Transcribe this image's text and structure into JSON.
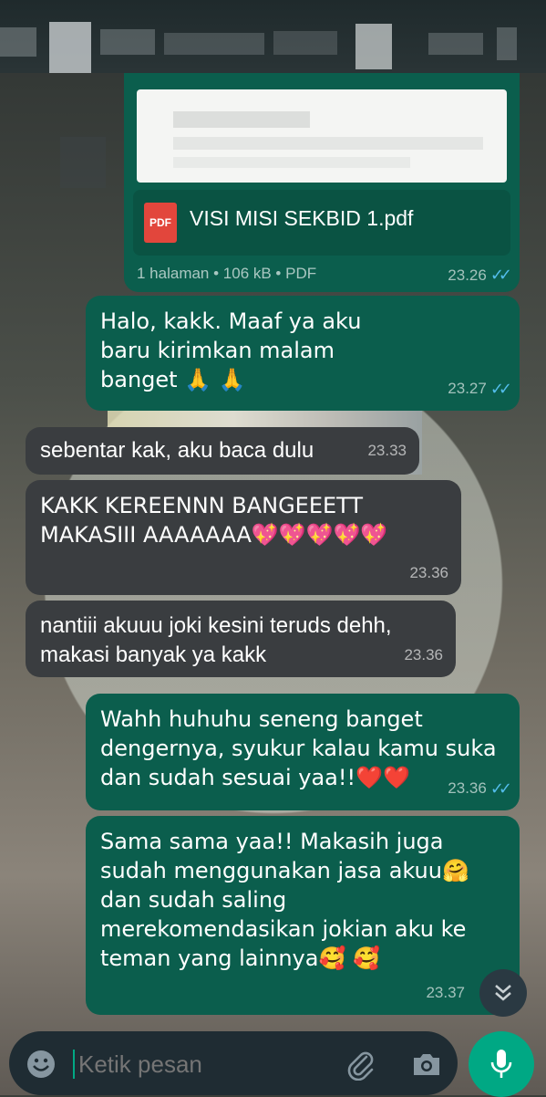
{
  "document": {
    "file_name": "VISI MISI SEKBID 1.pdf",
    "file_type_label": "PDF",
    "meta": "1 halaman • 106 kB • PDF",
    "time": "23.26"
  },
  "messages": [
    {
      "direction": "out",
      "text": "Halo, kakk. Maaf ya aku baru kirimkan malam banget 🙏 🙏",
      "time": "23.27"
    },
    {
      "direction": "in",
      "text": "sebentar kak, aku baca dulu",
      "time": "23.33"
    },
    {
      "direction": "in",
      "text": "KAKK KEREENNN BANGEEETT MAKASIII AAAAAAA💖💖💖💖💖",
      "time": "23.36"
    },
    {
      "direction": "in",
      "text": "nantiii akuuu joki kesini teruds dehh, makasi banyak ya kakk",
      "time": "23.36"
    },
    {
      "direction": "out",
      "text": "Wahh huhuhu seneng banget dengernya, syukur kalau kamu suka dan sudah sesuai yaa!!❤️❤️",
      "time": "23.36"
    },
    {
      "direction": "out",
      "text": "Sama sama yaa!! Makasih juga sudah menggunakan jasa akuu🤗 dan sudah saling merekomendasikan jokian aku ke teman yang lainnya🥰 🥰",
      "time": "23.37"
    }
  ],
  "composer": {
    "placeholder": "Ketik pesan"
  },
  "icons": {
    "emoji": "emoji-icon",
    "attach": "paperclip-icon",
    "camera": "camera-icon",
    "mic": "mic-icon",
    "scroll_down": "double-chevron-down-icon",
    "read_receipt": "double-check-icon"
  },
  "colors": {
    "outgoing_bubble": "#0b5e4d",
    "incoming_bubble": "#3a3d40",
    "read_ticks": "#53bdeb",
    "mic_button": "#00a884"
  }
}
